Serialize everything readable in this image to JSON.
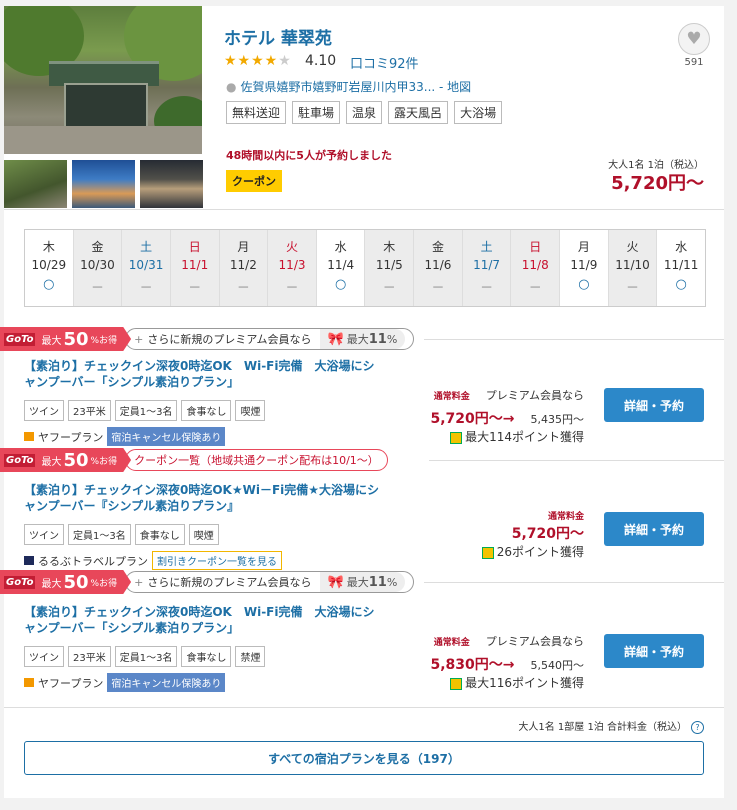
{
  "hotel": {
    "name": "ホテル 華翠苑",
    "score": "4.10",
    "reviews": "口コミ92件",
    "address": "佐賀県嬉野市嬉野町岩屋川内甲33...",
    "map": "地図",
    "favorite_count": "591",
    "rating_stars": 4,
    "amenities": [
      "無料送迎",
      "駐車場",
      "温泉",
      "露天風呂",
      "大浴場"
    ],
    "booked_notice": "48時間以内に5人が予約しました",
    "coupon": "クーポン",
    "price_caption": "大人1名 1泊（税込）",
    "price": "5,720円〜"
  },
  "calendar": [
    {
      "wk": "木",
      "date": "10/29",
      "mark": "○",
      "color": "normal",
      "avail": true
    },
    {
      "wk": "金",
      "date": "10/30",
      "mark": "－",
      "color": "normal",
      "avail": false
    },
    {
      "wk": "土",
      "date": "10/31",
      "mark": "－",
      "color": "blue",
      "avail": false
    },
    {
      "wk": "日",
      "date": "11/1",
      "mark": "－",
      "color": "red",
      "avail": false
    },
    {
      "wk": "月",
      "date": "11/2",
      "mark": "－",
      "color": "normal",
      "avail": false
    },
    {
      "wk": "火",
      "date": "11/3",
      "mark": "－",
      "color": "red",
      "avail": false
    },
    {
      "wk": "水",
      "date": "11/4",
      "mark": "○",
      "color": "normal",
      "avail": true
    },
    {
      "wk": "木",
      "date": "11/5",
      "mark": "－",
      "color": "normal",
      "avail": false
    },
    {
      "wk": "金",
      "date": "11/6",
      "mark": "－",
      "color": "normal",
      "avail": false
    },
    {
      "wk": "土",
      "date": "11/7",
      "mark": "－",
      "color": "blue",
      "avail": false
    },
    {
      "wk": "日",
      "date": "11/8",
      "mark": "－",
      "color": "red",
      "avail": false
    },
    {
      "wk": "月",
      "date": "11/9",
      "mark": "○",
      "color": "normal",
      "avail": true
    },
    {
      "wk": "火",
      "date": "11/10",
      "mark": "－",
      "color": "normal",
      "avail": false
    },
    {
      "wk": "水",
      "date": "11/11",
      "mark": "○",
      "color": "normal",
      "avail": true
    }
  ],
  "goto": {
    "logo": "GoTo",
    "max": "最大",
    "num": "50",
    "unit": "%お得",
    "plus": "+",
    "premium_text": "さらに新規のプレミアム会員なら",
    "premium_max": "最大",
    "premium_num": "11",
    "premium_unit": "%",
    "coupon_text": "クーポン一覧（地域共通クーポン配布は10/1〜）"
  },
  "plans": [
    {
      "title": "【素泊り】チェックイン深夜0時迄OK　Wi-Fi完備　大浴場にシャンプーバー「シンプル素泊りプラン」",
      "tags": [
        "ツイン",
        "23平米",
        "定員1〜3名",
        "食事なし",
        "喫煙"
      ],
      "provider": "ヤフープラン",
      "badge": "宿泊キャンセル保険あり",
      "label": "通常料金",
      "price": "5,720円〜→",
      "premium_label": "プレミアム会員なら",
      "premium_price": "5,435円〜",
      "points": "最大114ポイント獲得",
      "button": "詳細・予約"
    },
    {
      "title": "【素泊り】チェックイン深夜0時迄OK★Wi－Fi完備★大浴場にシャンプーバー『シンプル素泊りプラン』",
      "tags": [
        "ツイン",
        "定員1〜3名",
        "食事なし",
        "喫煙"
      ],
      "provider": "るるぶトラベルプラン",
      "badge": "割引きクーポン一覧を見る",
      "label": "通常料金",
      "price": "5,720円〜",
      "points": "26ポイント獲得",
      "button": "詳細・予約"
    },
    {
      "title": "【素泊り】チェックイン深夜0時迄OK　Wi-Fi完備　大浴場にシャンプーバー「シンプル素泊りプラン」",
      "tags": [
        "ツイン",
        "23平米",
        "定員1〜3名",
        "食事なし",
        "禁煙"
      ],
      "provider": "ヤフープラン",
      "badge": "宿泊キャンセル保険あり",
      "label": "通常料金",
      "price": "5,830円〜→",
      "premium_label": "プレミアム会員なら",
      "premium_price": "5,540円〜",
      "points": "最大116ポイント獲得",
      "button": "詳細・予約"
    }
  ],
  "footer": {
    "note": "大人1名 1部屋 1泊 合計料金（税込）",
    "help": "?",
    "all_plans": "すべての宿泊プランを見る（197）"
  }
}
